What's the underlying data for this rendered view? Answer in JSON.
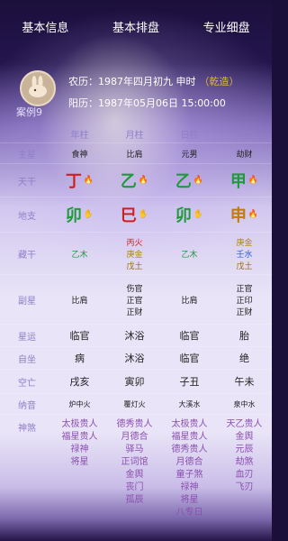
{
  "tabs": [
    "基本信息",
    "基本排盘",
    "专业细盘"
  ],
  "case_label": "案例9",
  "lunar_line": "农历：1987年四月初九 申时",
  "lunar_tag": "（乾造）",
  "solar_line": "阳历：1987年05月06日 15:00:00",
  "labels": {
    "date": "日期",
    "main_star": "主星",
    "tiangan": "天干",
    "dizhi": "地支",
    "canggan": "藏干",
    "fuxing": "副星",
    "xingyun": "星运",
    "zizuo": "自坐",
    "kongwang": "空亡",
    "nayin": "纳音",
    "shensha": "神煞"
  },
  "columns": [
    "年柱",
    "月柱",
    "日柱",
    "时柱"
  ],
  "main_stars": [
    "食神",
    "比肩",
    "元男",
    "劫财"
  ],
  "tiangan": [
    {
      "char": "丁",
      "color": "#d11f1f",
      "icon": "fire-icon"
    },
    {
      "char": "乙",
      "color": "#1e9a3a",
      "icon": "fire-icon"
    },
    {
      "char": "乙",
      "color": "#1e9a3a",
      "icon": "fire-icon"
    },
    {
      "char": "甲",
      "color": "#1e9a3a",
      "icon": "fire-icon"
    }
  ],
  "dizhi": [
    {
      "char": "卯",
      "color": "#1e9a3a",
      "icon": "hand-icon"
    },
    {
      "char": "巳",
      "color": "#d11f1f",
      "icon": "hand-icon"
    },
    {
      "char": "卯",
      "color": "#1e9a3a",
      "icon": "hand-icon"
    },
    {
      "char": "申",
      "color": "#c07a10",
      "icon": "fire-icon"
    }
  ],
  "canggan": [
    [
      "乙木"
    ],
    [
      "丙火",
      "庚金",
      "戊土"
    ],
    [
      "乙木"
    ],
    [
      "庚金",
      "壬水",
      "戊土"
    ]
  ],
  "fuxing": [
    [
      "比肩"
    ],
    [
      "伤官",
      "正官",
      "正财"
    ],
    [
      "比肩"
    ],
    [
      "正官",
      "正印",
      "正财"
    ]
  ],
  "xingyun": [
    "临官",
    "沐浴",
    "临官",
    "胎"
  ],
  "zizuo": [
    "病",
    "沐浴",
    "临官",
    "绝"
  ],
  "kongwang": [
    "戌亥",
    "寅卯",
    "子丑",
    "午未"
  ],
  "nayin": [
    "炉中火",
    "覆灯火",
    "大溪水",
    "泉中水"
  ],
  "shensha": [
    [
      "太极贵人",
      "福星贵人",
      "禄神",
      "将星"
    ],
    [
      "德秀贵人",
      "月德合",
      "驿马",
      "正词馆",
      "金舆",
      "丧门",
      "孤辰"
    ],
    [
      "太极贵人",
      "福星贵人",
      "德秀贵人",
      "月德合",
      "童子煞",
      "禄神",
      "将星",
      "八专日"
    ],
    [
      "天乙贵人",
      "金舆",
      "元辰",
      "劫煞",
      "血刃",
      "飞刃"
    ]
  ]
}
